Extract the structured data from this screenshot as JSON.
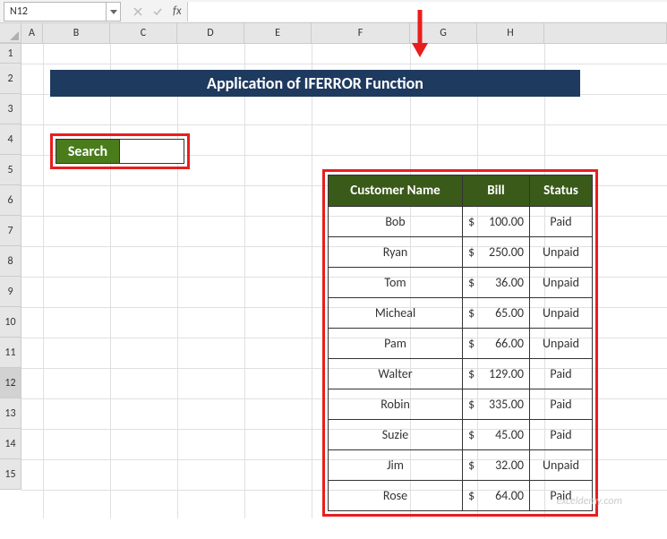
{
  "name_box": "N12",
  "formula_bar": "",
  "columns": [
    "",
    "A",
    "B",
    "C",
    "D",
    "E",
    "F",
    "G",
    "H",
    ""
  ],
  "rows": [
    "1",
    "2",
    "3",
    "4",
    "5",
    "6",
    "7",
    "8",
    "9",
    "10",
    "11",
    "12",
    "13",
    "14",
    "15"
  ],
  "title": "Application of IFERROR Function",
  "search_label": "Search",
  "table": {
    "headers": {
      "name": "Customer Name",
      "bill": "Bill",
      "status": "Status"
    },
    "rows": [
      {
        "name": "Bob",
        "bill": "100.00",
        "status": "Paid"
      },
      {
        "name": "Ryan",
        "bill": "250.00",
        "status": "Unpaid"
      },
      {
        "name": "Tom",
        "bill": "36.00",
        "status": "Unpaid"
      },
      {
        "name": "Micheal",
        "bill": "65.00",
        "status": "Unpaid"
      },
      {
        "name": "Pam",
        "bill": "66.00",
        "status": "Unpaid"
      },
      {
        "name": "Walter",
        "bill": "129.00",
        "status": "Paid"
      },
      {
        "name": "Robin",
        "bill": "335.00",
        "status": "Paid"
      },
      {
        "name": "Suzie",
        "bill": "45.00",
        "status": "Paid"
      },
      {
        "name": "Jim",
        "bill": "32.00",
        "status": "Unpaid"
      },
      {
        "name": "Rose",
        "bill": "64.00",
        "status": "Paid"
      }
    ]
  },
  "currency": "$",
  "watermark": "exceldemy.com"
}
